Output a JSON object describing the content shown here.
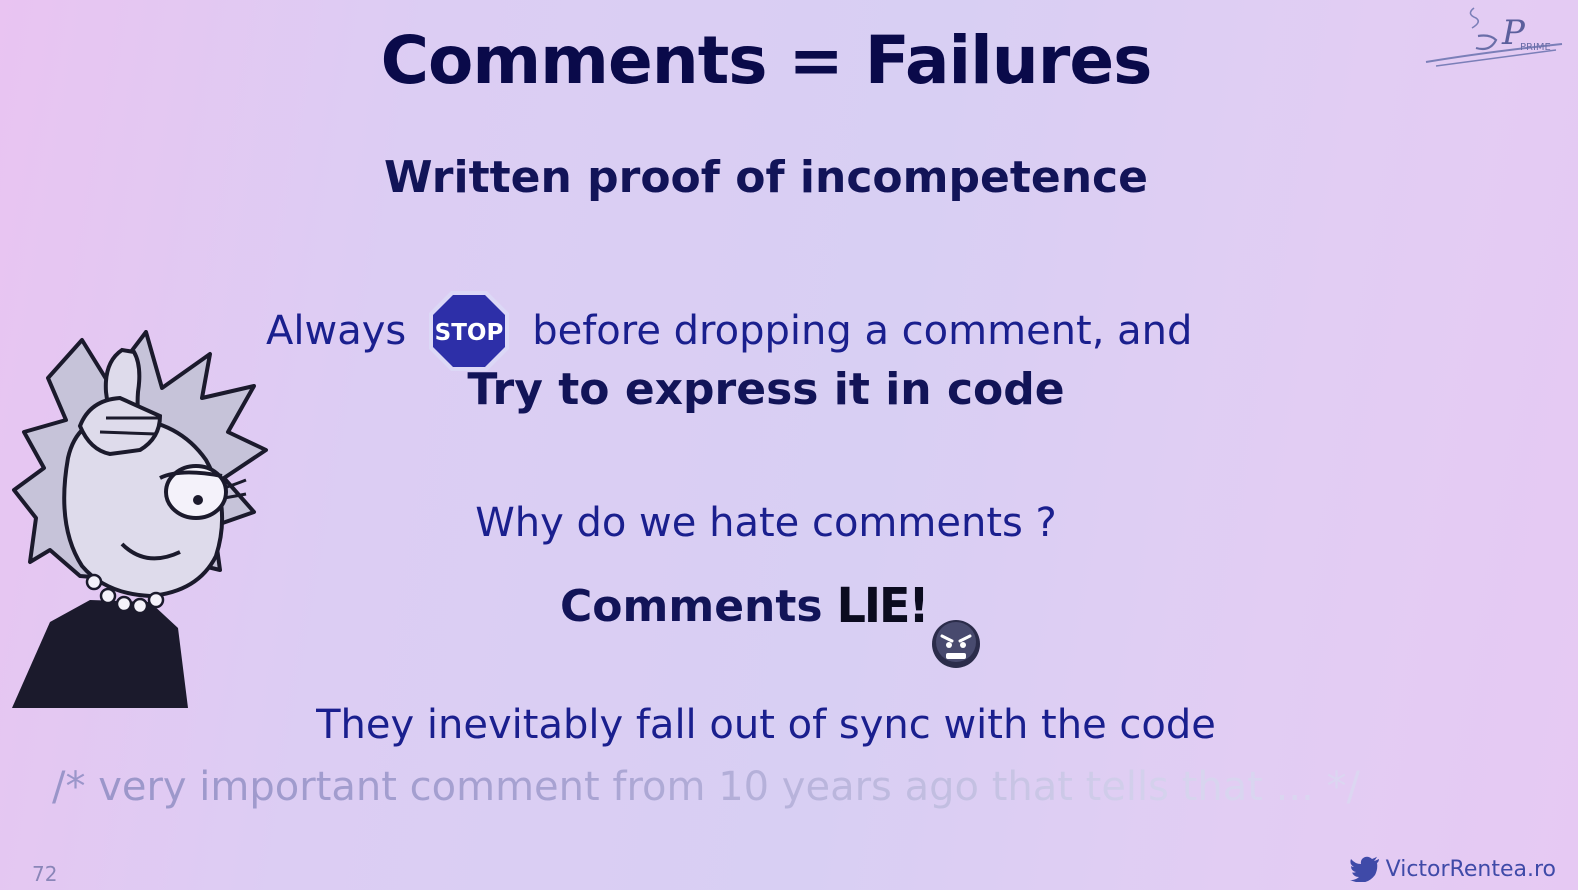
{
  "slide": {
    "title": "Comments = Failures",
    "subtitle": "Written proof of incompetence",
    "always_prefix": "Always",
    "stop_sign_text": "STOP",
    "always_suffix": "before dropping a comment, and",
    "try_line": "Try to express it in code",
    "why_line": "Why do we hate comments ?",
    "comments_prefix": "Comments",
    "lie_text": "LIE",
    "lie_punct": "!",
    "sync_line": "They inevitably fall out of sync with the code",
    "fading_comment": "/* very important comment from 10 years ago that tells that ... */",
    "page_number": "72",
    "footer_brand": "VictorRentea.ro"
  },
  "logo": {
    "text": "PRIME"
  },
  "icons": {
    "stop": "stop-sign-icon",
    "angry": "angry-face-icon",
    "twitter": "twitter-icon",
    "logo": "jprime-logo-icon",
    "character": "lisa-simpson-loser-illustration"
  },
  "colors": {
    "title": "#0a0a4a",
    "body": "#1a1f8e",
    "stop_sign": "#2d2fa8",
    "footer": "#3f4aa8"
  }
}
